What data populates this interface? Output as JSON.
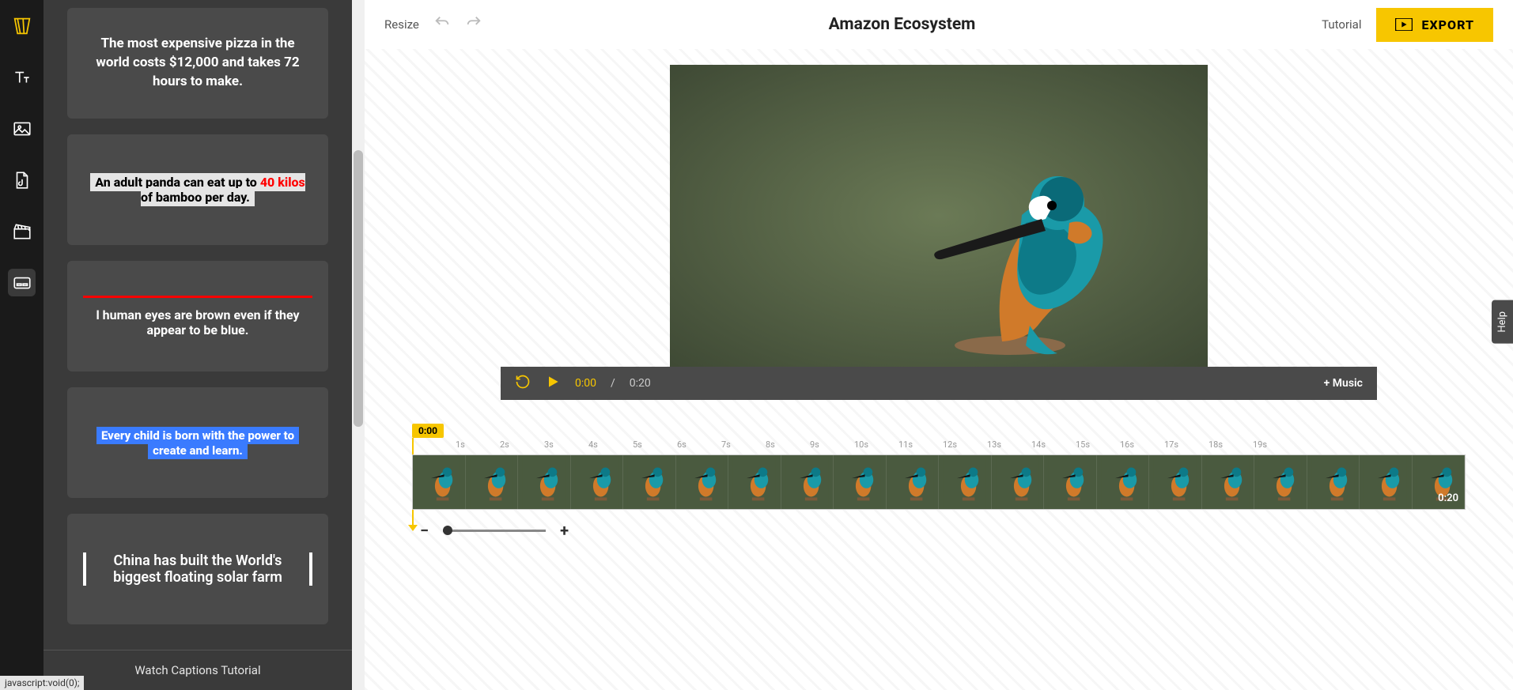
{
  "sidebar": {
    "tooltip": "CAPTIONS",
    "footer": "Watch Captions Tutorial",
    "cards": [
      {
        "text": "The most expensive pizza in the world costs $12,000 and takes 72 hours to make."
      },
      {
        "pre": "An adult panda can eat up to ",
        "hl": "40 kilos",
        "post": " of bamboo per day."
      },
      {
        "text": "l human eyes are brown even if they appear to be blue."
      },
      {
        "text": "Every child is born with the power to create and learn."
      },
      {
        "text": "China has built the World's biggest floating solar farm"
      }
    ]
  },
  "topbar": {
    "resize": "Resize",
    "title": "Amazon Ecosystem",
    "tutorial": "Tutorial",
    "export": "EXPORT"
  },
  "player": {
    "current": "0:00",
    "total": "0:20",
    "music": "+ Music"
  },
  "timeline": {
    "marker": "0:00",
    "ticks": [
      "1s",
      "2s",
      "3s",
      "4s",
      "5s",
      "6s",
      "7s",
      "8s",
      "9s",
      "10s",
      "11s",
      "12s",
      "13s",
      "14s",
      "15s",
      "16s",
      "17s",
      "18s",
      "19s"
    ],
    "clip_duration": "0:20"
  },
  "help": "Help",
  "status": "javascript:void(0);"
}
